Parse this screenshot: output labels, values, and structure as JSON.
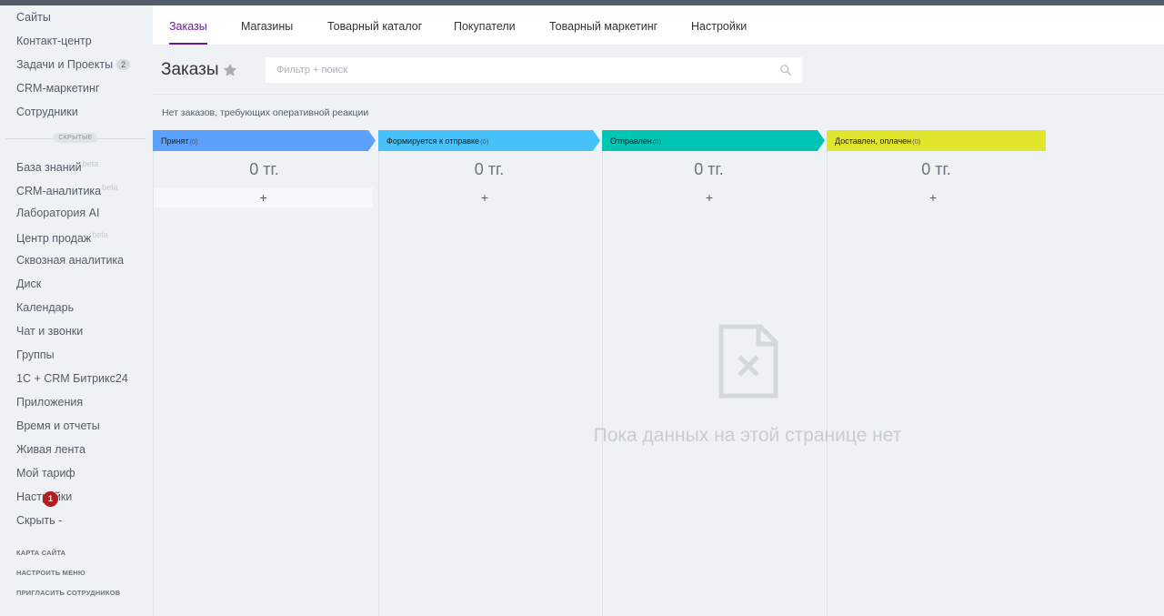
{
  "sidebar": {
    "items": [
      {
        "label": "Сайты"
      },
      {
        "label": "Контакт-центр"
      },
      {
        "label": "Задачи и Проекты",
        "counter": "2"
      },
      {
        "label": "CRM-маркетинг"
      },
      {
        "label": "Сотрудники"
      }
    ],
    "hidden_label": "СКРЫТЫЕ",
    "hidden_items": [
      {
        "label": "База знаний",
        "badge": "beta"
      },
      {
        "label": "CRM-аналитика",
        "badge": "beta"
      },
      {
        "label": "Лаборатория AI"
      },
      {
        "label": "Центр продаж",
        "badge": "beta"
      },
      {
        "label": "Сквозная аналитика"
      },
      {
        "label": "Диск"
      },
      {
        "label": "Календарь"
      },
      {
        "label": "Чат и звонки"
      },
      {
        "label": "Группы"
      },
      {
        "label": "1С + CRM Битрикс24"
      },
      {
        "label": "Приложения"
      },
      {
        "label": "Время и отчеты"
      },
      {
        "label": "Живая лента"
      },
      {
        "label": "Мой тариф"
      },
      {
        "label": "Настройки"
      },
      {
        "label": "Скрыть -"
      }
    ],
    "notification_count": "1",
    "footer_links": [
      "КАРТА САЙТА",
      "НАСТРОИТЬ МЕНЮ",
      "ПРИГЛАСИТЬ СОТРУДНИКОВ"
    ]
  },
  "tabs": [
    "Заказы",
    "Магазины",
    "Товарный каталог",
    "Покупатели",
    "Товарный маркетинг",
    "Настройки"
  ],
  "active_tab": "Заказы",
  "header": {
    "title": "Заказы",
    "search_placeholder": "Фильтр + поиск"
  },
  "notice": "Нет заказов, требующих оперативной реакции",
  "stages": [
    {
      "title": "Принят",
      "count": "(0)",
      "sum": "0 тг.",
      "color": "#5ba0fa"
    },
    {
      "title": "Формируется к отправке",
      "count": "(0)",
      "sum": "0 тг.",
      "color": "#47c1f9"
    },
    {
      "title": "Отправлен",
      "count": "(0)",
      "sum": "0 тг.",
      "color": "#00c4b4"
    },
    {
      "title": "Доставлен, оплачен",
      "count": "(0)",
      "sum": "0 тг.",
      "color": "#e2e52e"
    }
  ],
  "add_symbol": "+",
  "empty_state": "Пока данных на этой странице нет",
  "colors": {
    "accent": "#6a1b9a",
    "notification": "#b01e1e"
  }
}
